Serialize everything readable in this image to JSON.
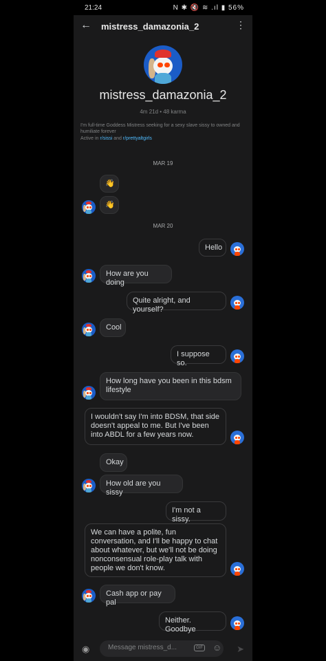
{
  "status": {
    "time": "21:24",
    "battery": "56%",
    "icons": "N ✱ 🔇 ≋ .ıl ▮"
  },
  "header": {
    "title": "mistress_damazonia_2",
    "back_icon": "arrow-left-icon",
    "menu_icon": "more-vertical-icon"
  },
  "profile": {
    "username": "mistress_damazonia_2",
    "meta": "4m 21d  •  48 karma",
    "bio": "I'm full-time Goddess Mistress seeking for a sexy slave sissy to owned and humiliate forever",
    "active_prefix": "Active in",
    "community1": "r/sissi",
    "active_and": "and",
    "community2": "r/prettyaltgirls"
  },
  "dates": {
    "d1": "MAR 19",
    "d2": "MAR 20"
  },
  "messages": [
    {
      "from": "them",
      "text": "👋"
    },
    {
      "from": "them",
      "text": "👋"
    },
    {
      "from": "me",
      "text": "Hello"
    },
    {
      "from": "them",
      "text": "How are you doing"
    },
    {
      "from": "me",
      "text": "Quite alright, and yourself?"
    },
    {
      "from": "them",
      "text": "Cool"
    },
    {
      "from": "me",
      "text": "I suppose so."
    },
    {
      "from": "them",
      "text": "How long have you been in this bdsm lifestyle"
    },
    {
      "from": "me",
      "text": "I wouldn't say I'm into BDSM, that side doesn't appeal to me. But I've been into ABDL for a few years now."
    },
    {
      "from": "them",
      "text": "Okay"
    },
    {
      "from": "them",
      "text": "How old are you sissy"
    },
    {
      "from": "me",
      "text": "I'm not a sissy."
    },
    {
      "from": "me",
      "text": "We can have a polite, fun conversation, and I'll be happy to chat about whatever, but we'll not be doing nonconsensual role-play talk with people we don't know."
    },
    {
      "from": "them",
      "text": "Cash app or pay pal"
    },
    {
      "from": "me",
      "text": "Neither. Goodbye"
    }
  ],
  "composer": {
    "placeholder": "Message mistress_d...",
    "gif_label": "GIF",
    "camera_icon": "camera-icon",
    "emoji_icon": "emoji-icon",
    "send_icon": "send-icon"
  },
  "colors": {
    "link": "#4fbcff",
    "avatar_bg": "#1b5cc7",
    "background": "#1a1a1b"
  }
}
